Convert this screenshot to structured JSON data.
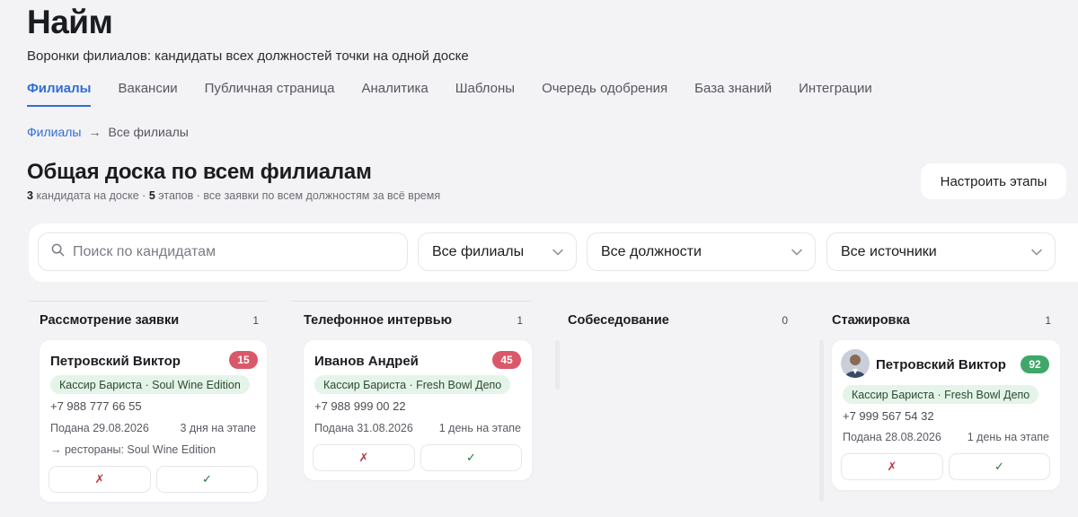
{
  "header": {
    "title": "Найм",
    "subtitle": "Воронки филиалов: кандидаты всех должностей точки на одной доске"
  },
  "tabs": [
    {
      "label": "Филиалы",
      "active": true
    },
    {
      "label": "Вакансии",
      "active": false
    },
    {
      "label": "Публичная страница",
      "active": false
    },
    {
      "label": "Аналитика",
      "active": false
    },
    {
      "label": "Шаблоны",
      "active": false
    },
    {
      "label": "Очередь одобрения",
      "active": false
    },
    {
      "label": "База знаний",
      "active": false
    },
    {
      "label": "Интеграции",
      "active": false
    }
  ],
  "breadcrumb": {
    "parent": "Филиалы",
    "separator": "→",
    "current": "Все филиалы"
  },
  "board": {
    "title": "Общая доска по всем филиалам",
    "candidates_count": "3",
    "candidates_label": "кандидата на доске",
    "dot1": "·",
    "stages_count": "5",
    "stages_label": "этапов",
    "scope_text": "· все заявки по всем должностям за всё время",
    "configure_label": "Настроить этапы"
  },
  "filters": {
    "search_placeholder": "Поиск по кандидатам",
    "branch": "Все филиалы",
    "position": "Все должности",
    "source": "Все источники"
  },
  "columns": [
    {
      "title": "Рассмотрение заявки",
      "count": "1",
      "card": {
        "name": "Петровский Виктор",
        "score": "15",
        "tag": "Кассир Бариста · Soul Wine Edition",
        "phone": "+7 988 777 66 55",
        "submitted": "Подана 29.08.2026",
        "in_stage": "3 дня на этапе",
        "note": "→ рестораны: Soul Wine Edition",
        "reject": "✗",
        "approve": "✓"
      }
    },
    {
      "title": "Телефонное интервью",
      "count": "1",
      "card": {
        "name": "Иванов Андрей",
        "score": "45",
        "tag": "Кассир Бариста · Fresh Bowl Депо",
        "phone": "+7 988 999 00 22",
        "submitted": "Подана 31.08.2026",
        "in_stage": "1 день на этапе",
        "reject": "✗",
        "approve": "✓"
      }
    },
    {
      "title": "Собеседование",
      "count": "0"
    },
    {
      "title": "Стажировка",
      "count": "1",
      "card": {
        "name": "Петровский Виктор",
        "score": "92",
        "tag": "Кассир Бариста · Fresh Bowl Депо",
        "phone": "+7 999 567 54 32",
        "submitted": "Подана 28.08.2026",
        "in_stage": "1 день на этапе",
        "reject": "✗",
        "approve": "✓"
      }
    }
  ],
  "colors": {
    "accent": "#2f6fd6",
    "score_low": "#d9596a",
    "score_high": "#3fa76a",
    "tag_bg": "#e4f4e8"
  }
}
